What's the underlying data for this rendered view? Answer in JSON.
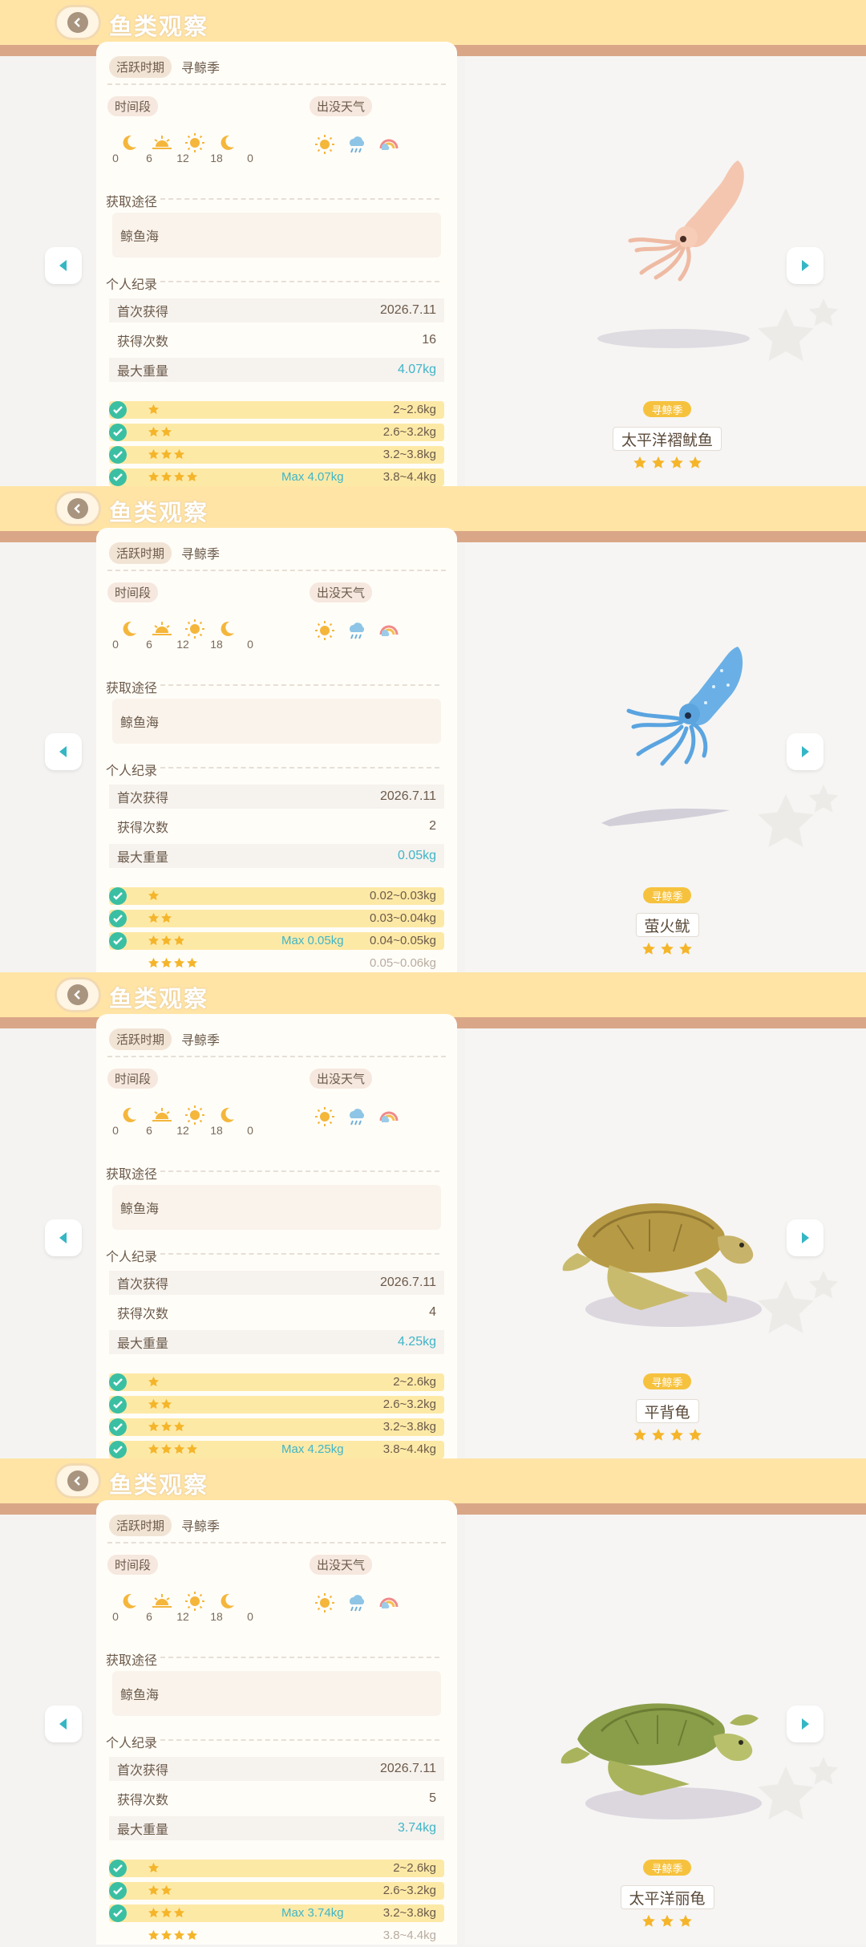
{
  "app_title": "鱼类观察",
  "colors": {
    "accent_teal": "#3fb5c7",
    "check_green": "#3bbfa3",
    "topbar": "#ffe4a6",
    "tier_fill": "#fde9a6"
  },
  "panels": [
    {
      "season_label": "活跃时期",
      "season_value": "寻鲸季",
      "time_label": "时间段",
      "weather_label": "出没天气",
      "time_ticks": [
        "0",
        "6",
        "12",
        "18",
        "0"
      ],
      "time_icons": [
        "moon-icon",
        "sunrise-icon",
        "sun-icon",
        "moon-icon"
      ],
      "weather_icons": [
        "sun-icon",
        "rain-cloud-icon",
        "rainbow-icon"
      ],
      "source_label": "获取途径",
      "source_value": "鲸鱼海",
      "record_label": "个人纪录",
      "first_label": "首次获得",
      "first_value": "2026.7.11",
      "count_label": "获得次数",
      "count_value": "16",
      "weight_label": "最大重量",
      "weight_value": "4.07kg",
      "tiers": [
        {
          "stars": 1,
          "range": "2~2.6kg",
          "max": "",
          "done": true
        },
        {
          "stars": 2,
          "range": "2.6~3.2kg",
          "max": "",
          "done": true
        },
        {
          "stars": 3,
          "range": "3.2~3.8kg",
          "max": "",
          "done": true
        },
        {
          "stars": 4,
          "range": "3.8~4.4kg",
          "max": "Max 4.07kg",
          "done": true
        }
      ],
      "tag": "寻鲸季",
      "fish_name": "太平洋褶鱿鱼",
      "rarity": 4,
      "fish_kind": "squid-pink"
    },
    {
      "season_label": "活跃时期",
      "season_value": "寻鲸季",
      "time_label": "时间段",
      "weather_label": "出没天气",
      "time_ticks": [
        "0",
        "6",
        "12",
        "18",
        "0"
      ],
      "time_icons": [
        "moon-icon",
        "sunrise-icon",
        "sun-icon",
        "moon-icon"
      ],
      "weather_icons": [
        "sun-icon",
        "rain-cloud-icon",
        "rainbow-icon"
      ],
      "source_label": "获取途径",
      "source_value": "鲸鱼海",
      "record_label": "个人纪录",
      "first_label": "首次获得",
      "first_value": "2026.7.11",
      "count_label": "获得次数",
      "count_value": "2",
      "weight_label": "最大重量",
      "weight_value": "0.05kg",
      "tiers": [
        {
          "stars": 1,
          "range": "0.02~0.03kg",
          "max": "",
          "done": true
        },
        {
          "stars": 2,
          "range": "0.03~0.04kg",
          "max": "",
          "done": true
        },
        {
          "stars": 3,
          "range": "0.04~0.05kg",
          "max": "Max 0.05kg",
          "done": true
        },
        {
          "stars": 4,
          "range": "0.05~0.06kg",
          "max": "",
          "done": false
        }
      ],
      "tag": "寻鲸季",
      "fish_name": "萤火鱿",
      "rarity": 3,
      "fish_kind": "squid-blue"
    },
    {
      "season_label": "活跃时期",
      "season_value": "寻鲸季",
      "time_label": "时间段",
      "weather_label": "出没天气",
      "time_ticks": [
        "0",
        "6",
        "12",
        "18",
        "0"
      ],
      "time_icons": [
        "moon-icon",
        "sunrise-icon",
        "sun-icon",
        "moon-icon"
      ],
      "weather_icons": [
        "sun-icon",
        "rain-cloud-icon",
        "rainbow-icon"
      ],
      "source_label": "获取途径",
      "source_value": "鲸鱼海",
      "record_label": "个人纪录",
      "first_label": "首次获得",
      "first_value": "2026.7.11",
      "count_label": "获得次数",
      "count_value": "4",
      "weight_label": "最大重量",
      "weight_value": "4.25kg",
      "tiers": [
        {
          "stars": 1,
          "range": "2~2.6kg",
          "max": "",
          "done": true
        },
        {
          "stars": 2,
          "range": "2.6~3.2kg",
          "max": "",
          "done": true
        },
        {
          "stars": 3,
          "range": "3.2~3.8kg",
          "max": "",
          "done": true
        },
        {
          "stars": 4,
          "range": "3.8~4.4kg",
          "max": "Max 4.25kg",
          "done": true
        }
      ],
      "tag": "寻鲸季",
      "fish_name": "平背龟",
      "rarity": 4,
      "fish_kind": "turtle-brown"
    },
    {
      "season_label": "活跃时期",
      "season_value": "寻鲸季",
      "time_label": "时间段",
      "weather_label": "出没天气",
      "time_ticks": [
        "0",
        "6",
        "12",
        "18",
        "0"
      ],
      "time_icons": [
        "moon-icon",
        "sunrise-icon",
        "sun-icon",
        "moon-icon"
      ],
      "weather_icons": [
        "sun-icon",
        "rain-cloud-icon",
        "rainbow-icon"
      ],
      "source_label": "获取途径",
      "source_value": "鲸鱼海",
      "record_label": "个人纪录",
      "first_label": "首次获得",
      "first_value": "2026.7.11",
      "count_label": "获得次数",
      "count_value": "5",
      "weight_label": "最大重量",
      "weight_value": "3.74kg",
      "tiers": [
        {
          "stars": 1,
          "range": "2~2.6kg",
          "max": "",
          "done": true
        },
        {
          "stars": 2,
          "range": "2.6~3.2kg",
          "max": "",
          "done": true
        },
        {
          "stars": 3,
          "range": "3.2~3.8kg",
          "max": "Max 3.74kg",
          "done": true
        },
        {
          "stars": 4,
          "range": "3.8~4.4kg",
          "max": "",
          "done": false
        }
      ],
      "tag": "寻鲸季",
      "fish_name": "太平洋丽龟",
      "rarity": 3,
      "fish_kind": "turtle-green"
    }
  ]
}
